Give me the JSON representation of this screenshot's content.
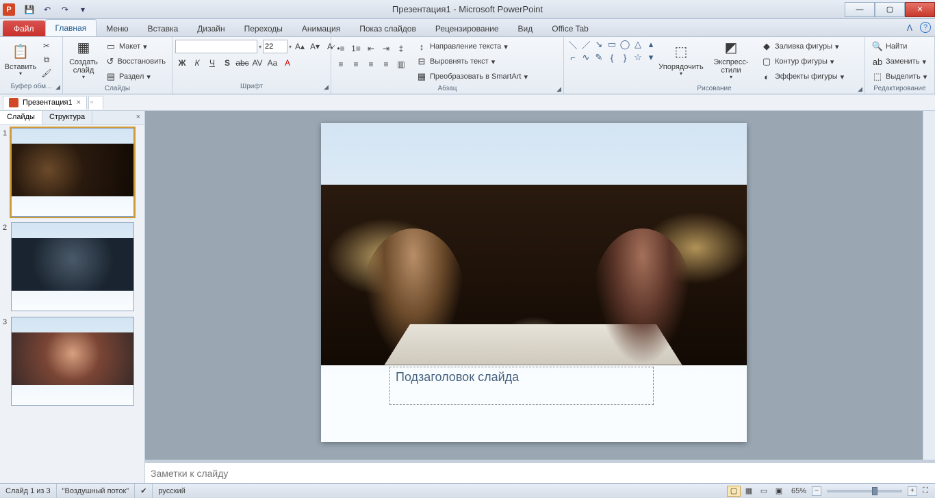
{
  "titlebar": {
    "title": "Презентация1 - Microsoft PowerPoint",
    "qat": {
      "save": "💾",
      "undo": "↶",
      "redo": "↷",
      "more": "▾"
    }
  },
  "window_controls": {
    "min": "—",
    "max": "▢",
    "close": "✕"
  },
  "ribbon": {
    "file_label": "Файл",
    "tabs": [
      "Главная",
      "Меню",
      "Вставка",
      "Дизайн",
      "Переходы",
      "Анимация",
      "Показ слайдов",
      "Рецензирование",
      "Вид",
      "Office Tab"
    ],
    "active_tab": "Главная",
    "groups": {
      "clipboard": {
        "label": "Буфер обм...",
        "paste": "Вставить"
      },
      "slides": {
        "label": "Слайды",
        "new_slide": "Создать\nслайд",
        "layout": "Макет",
        "reset": "Восстановить",
        "section": "Раздел"
      },
      "font": {
        "label": "Шрифт",
        "font_name": "",
        "font_size": "22"
      },
      "paragraph": {
        "label": "Абзац",
        "text_direction": "Направление текста",
        "align_text": "Выровнять текст",
        "smartart": "Преобразовать в SmartArt"
      },
      "drawing": {
        "label": "Рисование",
        "arrange": "Упорядочить",
        "quick_styles": "Экспресс-стили",
        "shape_fill": "Заливка фигуры",
        "shape_outline": "Контур фигуры",
        "shape_effects": "Эффекты фигуры"
      },
      "editing": {
        "label": "Редактирование",
        "find": "Найти",
        "replace": "Заменить",
        "select": "Выделить"
      }
    }
  },
  "doc_tabs": {
    "tab1": "Презентация1"
  },
  "side_panel": {
    "tab_slides": "Слайды",
    "tab_outline": "Структура",
    "slides": [
      1,
      2,
      3
    ]
  },
  "slide": {
    "subtitle_placeholder": "Подзаголовок слайда"
  },
  "notes": {
    "placeholder": "Заметки к слайду"
  },
  "status": {
    "slide_count": "Слайд 1 из 3",
    "theme": "\"Воздушный поток\"",
    "language": "русский",
    "zoom": "65%"
  }
}
